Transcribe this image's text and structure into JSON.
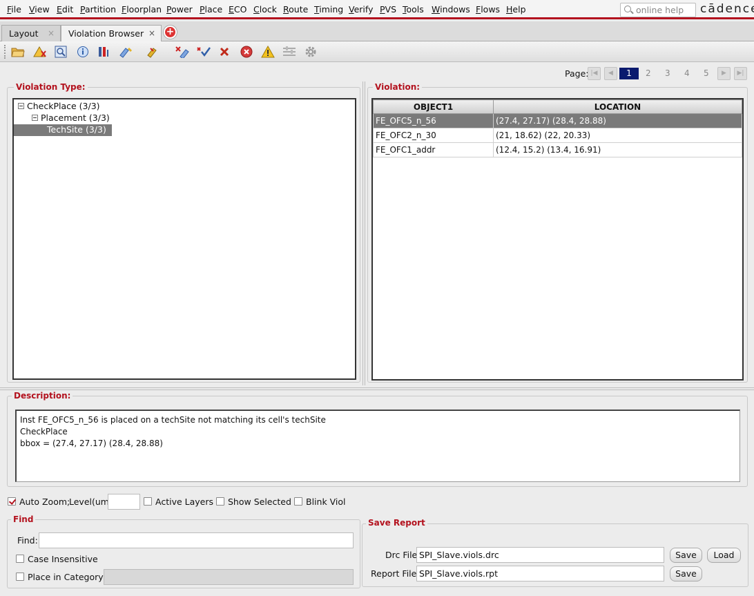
{
  "menubar": {
    "items": [
      "File",
      "View",
      "Edit",
      "Partition",
      "Floorplan",
      "Power",
      "Place",
      "ECO",
      "Clock",
      "Route",
      "Timing",
      "Verify",
      "PVS",
      "Tools",
      "Windows",
      "Flows",
      "Help"
    ],
    "search_placeholder": "online help",
    "logo": "cādence"
  },
  "tabs": [
    {
      "label": "Layout",
      "close": "×"
    },
    {
      "label": "Violation Browser",
      "close": "×"
    }
  ],
  "toolbar": {
    "icons": [
      "open-folder-icon",
      "auto-fix-icon",
      "zoom-fit-icon",
      "info-icon",
      "filter-icon",
      "highlight-icon",
      "edit-highlight-icon",
      "clear-highlight-icon",
      "check-icon",
      "delete-icon",
      "stop-icon",
      "warning-icon",
      "settings-list-icon",
      "gear-icon"
    ]
  },
  "pager": {
    "label": "Page:",
    "pages": [
      "1",
      "2",
      "3",
      "4",
      "5"
    ],
    "current": "1"
  },
  "violation_type": {
    "title": "Violation Type:",
    "tree": [
      {
        "label": "CheckPlace (3/3)",
        "level": 0
      },
      {
        "label": "Placement (3/3)",
        "level": 1
      },
      {
        "label": "TechSite (3/3)",
        "level": 2,
        "selected": true
      }
    ]
  },
  "violation": {
    "title": "Violation:",
    "columns": [
      "OBJECT1",
      "LOCATION"
    ],
    "rows": [
      {
        "object": "FE_OFC5_n_56",
        "location": "(27.4, 27.17) (28.4, 28.88)",
        "selected": true
      },
      {
        "object": "FE_OFC2_n_30",
        "location": "(21, 18.62) (22, 20.33)"
      },
      {
        "object": "FE_OFC1_addr",
        "location": "(12.4, 15.2) (13.4, 16.91)"
      }
    ]
  },
  "description": {
    "title": "Description:",
    "lines": [
      "Inst FE_OFC5_n_56 is placed on a techSite not matching its cell's techSite",
      "CheckPlace",
      "bbox = (27.4, 27.17) (28.4, 28.88)"
    ]
  },
  "options": {
    "auto_zoom": "Auto Zoom;",
    "level_label": "Level(um)",
    "level_value": "",
    "active_layers": "Active Layers",
    "show_selected": "Show Selected",
    "blink_viol": "Blink Viol"
  },
  "find": {
    "title": "Find",
    "find_label": "Find:",
    "find_value": "",
    "case_insensitive": "Case Insensitive",
    "place_in_category": "Place in Category"
  },
  "save_report": {
    "title": "Save Report",
    "drc_label": "Drc File:",
    "drc_value": "SPI_Slave.viols.drc",
    "report_label": "Report File:",
    "report_value": "SPI_Slave.viols.rpt",
    "save": "Save",
    "load": "Load"
  },
  "colors": {
    "accent": "#b3121e",
    "selection": "#7a7a7a",
    "page_current": "#0a1a6e"
  }
}
